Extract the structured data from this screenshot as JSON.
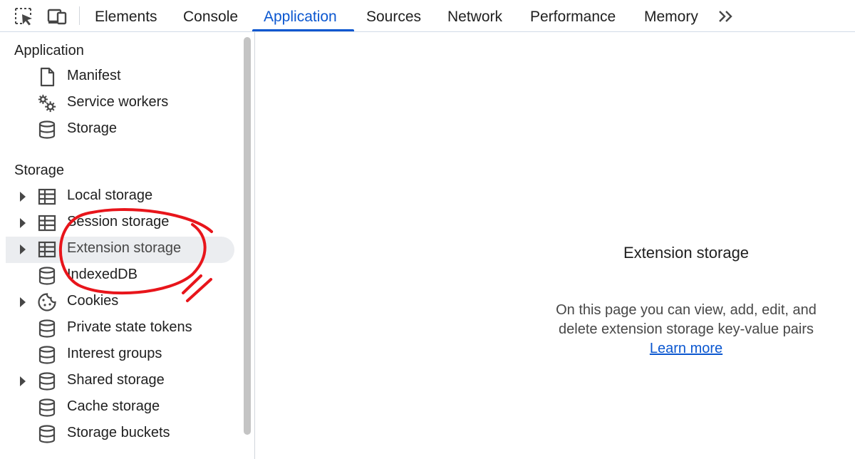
{
  "toolbar": {
    "inspect_icon": "inspect-element-icon",
    "device_icon": "device-toolbar-icon",
    "tabs": [
      {
        "label": "Elements",
        "active": false
      },
      {
        "label": "Console",
        "active": false
      },
      {
        "label": "Application",
        "active": true
      },
      {
        "label": "Sources",
        "active": false
      },
      {
        "label": "Network",
        "active": false
      },
      {
        "label": "Performance",
        "active": false
      },
      {
        "label": "Memory",
        "active": false
      }
    ],
    "more_label": ">>"
  },
  "sidebar": {
    "application_section": "Application",
    "application_items": [
      {
        "label": "Manifest",
        "icon": "document-icon"
      },
      {
        "label": "Service workers",
        "icon": "gears-icon"
      },
      {
        "label": "Storage",
        "icon": "database-icon"
      }
    ],
    "storage_section": "Storage",
    "storage_items": [
      {
        "label": "Local storage",
        "icon": "table-icon",
        "expandable": true
      },
      {
        "label": "Session storage",
        "icon": "table-icon",
        "expandable": true
      },
      {
        "label": "Extension storage",
        "icon": "table-icon",
        "expandable": true,
        "selected": true
      },
      {
        "label": "IndexedDB",
        "icon": "database-icon",
        "expandable": false
      },
      {
        "label": "Cookies",
        "icon": "cookie-icon",
        "expandable": true
      },
      {
        "label": "Private state tokens",
        "icon": "database-icon",
        "expandable": false
      },
      {
        "label": "Interest groups",
        "icon": "database-icon",
        "expandable": false
      },
      {
        "label": "Shared storage",
        "icon": "database-icon",
        "expandable": true
      },
      {
        "label": "Cache storage",
        "icon": "database-icon",
        "expandable": false
      },
      {
        "label": "Storage buckets",
        "icon": "database-icon",
        "expandable": false
      }
    ]
  },
  "main": {
    "title": "Extension storage",
    "description": "On this page you can view, add, edit, and delete extension storage key-value pairs.",
    "learn_more": "Learn more"
  },
  "colors": {
    "accent": "#0b57d0",
    "selected_row": "#ebedf0",
    "annotation": "#e8151b"
  }
}
